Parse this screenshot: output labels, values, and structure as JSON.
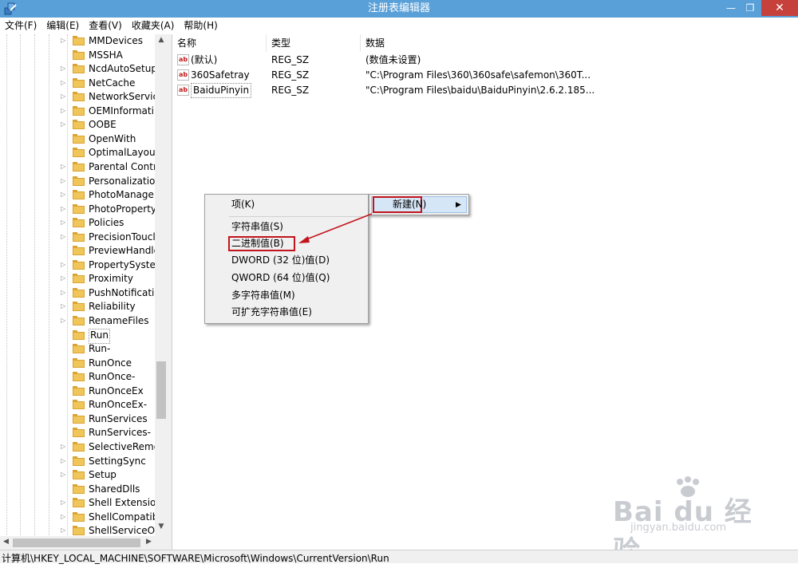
{
  "window": {
    "title": "注册表编辑器",
    "min_glyph": "—",
    "max_glyph": "❐",
    "close_glyph": "✕"
  },
  "menu": [
    "文件(F)",
    "编辑(E)",
    "查看(V)",
    "收藏夹(A)",
    "帮助(H)"
  ],
  "tree": {
    "items": [
      {
        "label": "MMDevices",
        "expandable": true
      },
      {
        "label": "MSSHA",
        "expandable": false
      },
      {
        "label": "NcdAutoSetup",
        "expandable": true
      },
      {
        "label": "NetCache",
        "expandable": true
      },
      {
        "label": "NetworkServic",
        "expandable": true
      },
      {
        "label": "OEMInformati",
        "expandable": true
      },
      {
        "label": "OOBE",
        "expandable": true
      },
      {
        "label": "OpenWith",
        "expandable": false
      },
      {
        "label": "OptimalLayout",
        "expandable": false
      },
      {
        "label": "Parental Contr",
        "expandable": true
      },
      {
        "label": "Personalizatio",
        "expandable": true
      },
      {
        "label": "PhotoManage",
        "expandable": true
      },
      {
        "label": "PhotoProperty",
        "expandable": true
      },
      {
        "label": "Policies",
        "expandable": true
      },
      {
        "label": "PrecisionToucl",
        "expandable": true
      },
      {
        "label": "PreviewHandle",
        "expandable": false
      },
      {
        "label": "PropertySyster",
        "expandable": true
      },
      {
        "label": "Proximity",
        "expandable": true
      },
      {
        "label": "PushNotificati",
        "expandable": true
      },
      {
        "label": "Reliability",
        "expandable": true
      },
      {
        "label": "RenameFiles",
        "expandable": true
      },
      {
        "label": "Run",
        "expandable": false,
        "selected": true
      },
      {
        "label": "Run-",
        "expandable": false
      },
      {
        "label": "RunOnce",
        "expandable": false
      },
      {
        "label": "RunOnce-",
        "expandable": false
      },
      {
        "label": "RunOnceEx",
        "expandable": false
      },
      {
        "label": "RunOnceEx-",
        "expandable": false
      },
      {
        "label": "RunServices",
        "expandable": false
      },
      {
        "label": "RunServices-",
        "expandable": false
      },
      {
        "label": "SelectiveRemo",
        "expandable": true
      },
      {
        "label": "SettingSync",
        "expandable": true
      },
      {
        "label": "Setup",
        "expandable": true
      },
      {
        "label": "SharedDlls",
        "expandable": false
      },
      {
        "label": "Shell Extension",
        "expandable": true
      },
      {
        "label": "ShellCompatib",
        "expandable": true
      },
      {
        "label": "ShellServiceOb",
        "expandable": true
      }
    ]
  },
  "list": {
    "columns": {
      "name": "名称",
      "type": "类型",
      "data": "数据"
    },
    "icon_text": "ab",
    "rows": [
      {
        "name": "(默认)",
        "type": "REG_SZ",
        "data": "(数值未设置)"
      },
      {
        "name": "360Safetray",
        "type": "REG_SZ",
        "data": "\"C:\\Program Files\\360\\360safe\\safemon\\360T..."
      },
      {
        "name": "BaiduPinyin",
        "type": "REG_SZ",
        "data": "\"C:\\Program Files\\baidu\\BaiduPinyin\\2.6.2.185...",
        "focused": true
      }
    ]
  },
  "context_menu": {
    "items": [
      "项(K)",
      "字符串值(S)",
      "二进制值(B)",
      "DWORD (32 位)值(D)",
      "QWORD (64 位)值(Q)",
      "多字符串值(M)",
      "可扩充字符串值(E)"
    ],
    "submenu_label": "新建(N)",
    "submenu_arrow": "▶"
  },
  "status": {
    "path": "计算机\\HKEY_LOCAL_MACHINE\\SOFTWARE\\Microsoft\\Windows\\CurrentVersion\\Run"
  },
  "colors": {
    "titlebar": "#5aa0d8",
    "close_button": "#c7413c",
    "annotation_red": "#c1141c"
  }
}
